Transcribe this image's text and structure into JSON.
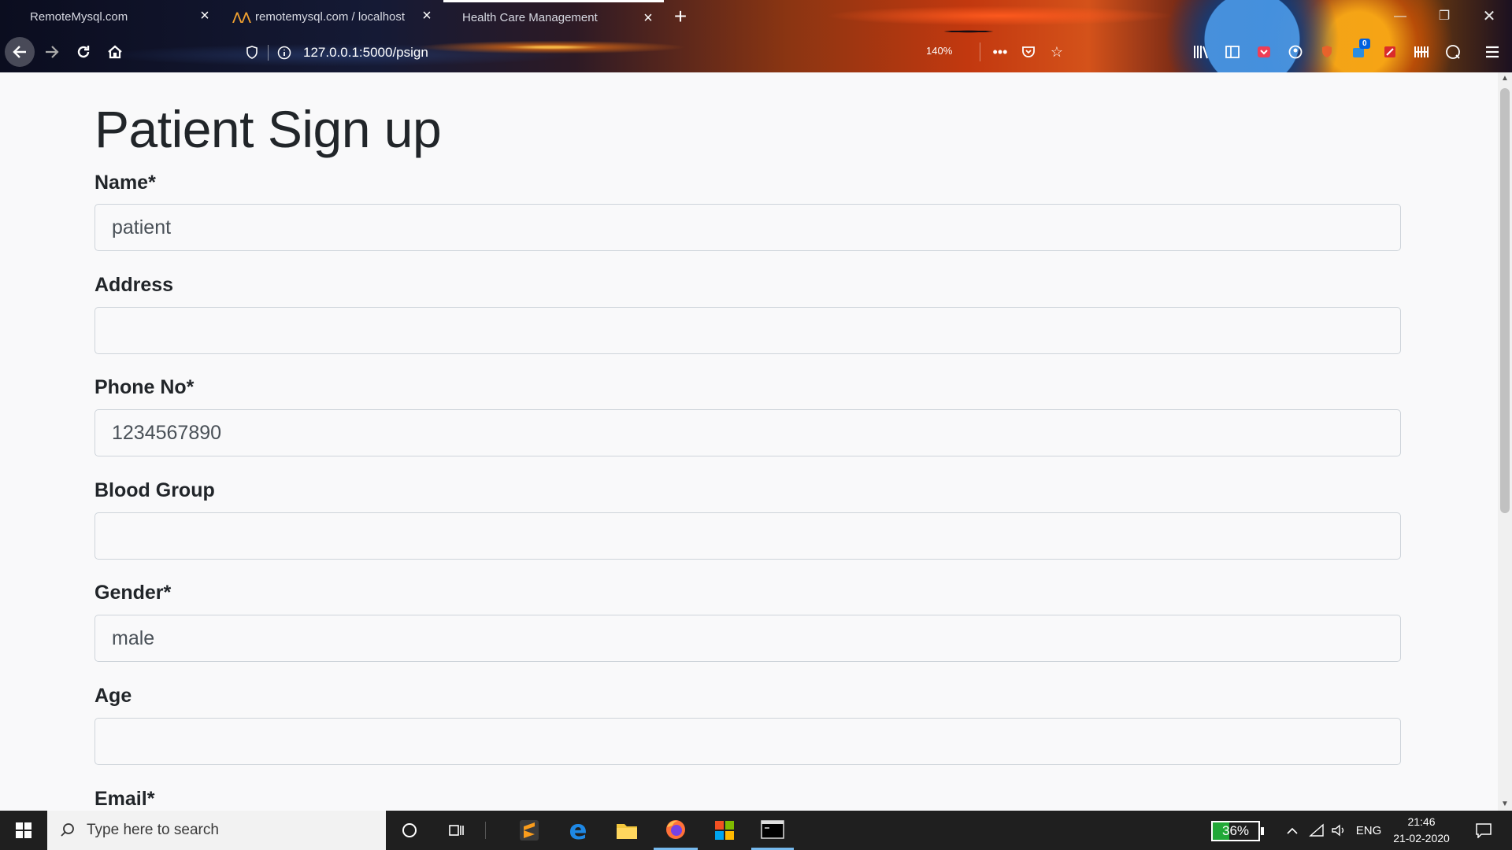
{
  "browser": {
    "tabs": [
      {
        "title": "RemoteMysql.com",
        "active": false
      },
      {
        "title": "remotemysql.com / localhost",
        "active": false
      },
      {
        "title": "Health Care Management",
        "active": true
      }
    ],
    "url": "127.0.0.1:5000/psign",
    "zoom": "140%",
    "extension_badge": "0"
  },
  "page": {
    "title": "Patient Sign up",
    "fields": [
      {
        "label": "Name*",
        "value": "patient"
      },
      {
        "label": "Address",
        "value": ""
      },
      {
        "label": "Phone No*",
        "value": "1234567890"
      },
      {
        "label": "Blood Group",
        "value": ""
      },
      {
        "label": "Gender*",
        "value": "male"
      },
      {
        "label": "Age",
        "value": ""
      },
      {
        "label": "Email*",
        "value": ""
      }
    ]
  },
  "taskbar": {
    "search_placeholder": "Type here to search",
    "battery": "36%",
    "language": "ENG",
    "time": "21:46",
    "date": "21-02-2020"
  },
  "colors": {
    "taskbar": "#1f1f1f",
    "battery_fill": "#21a837",
    "page_bg": "#f9f9fa",
    "input_border": "#ced4da"
  }
}
